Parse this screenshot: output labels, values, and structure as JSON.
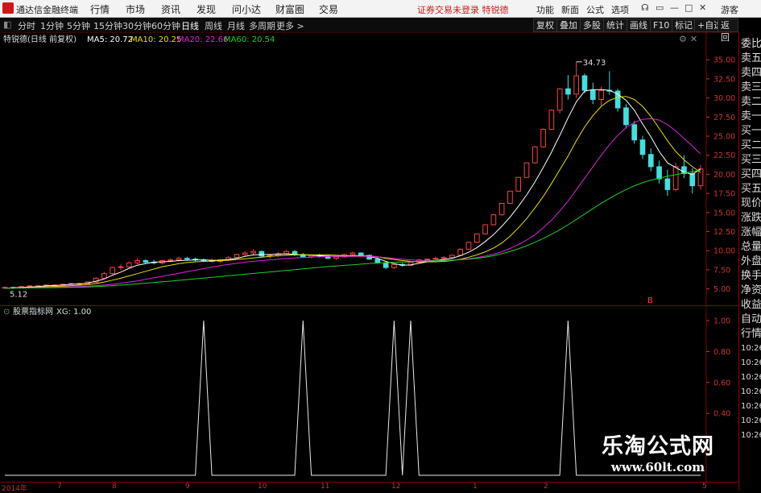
{
  "app": {
    "title": "通达信金融终端"
  },
  "menu": [
    "行情",
    "市场",
    "资讯",
    "发现",
    "问小达",
    "财富圈",
    "交易"
  ],
  "warning": "证券交易未登录 特锐德",
  "toolbar_right": [
    "功能",
    "新面",
    "公式",
    "选项"
  ],
  "user": "游客",
  "periods": [
    "分时",
    "1分钟",
    "5分钟",
    "15分钟",
    "30分钟",
    "60分钟",
    "日线",
    "周线",
    "月线",
    "多周期",
    "更多 >"
  ],
  "active_period": "日线",
  "right_tabs": [
    "复权",
    "叠加",
    "多股",
    "统计",
    "画线",
    "F10",
    "标记",
    "+自选",
    "返回"
  ],
  "info_line": {
    "stock": "特锐德(日线 前复权)",
    "ma5": "MA5: 20.72",
    "ma10": "MA10: 20.25",
    "ma20": "MA20: 22.66",
    "ma60": "MA60: 20.54"
  },
  "indicator_line": {
    "name": "股票指标网",
    "value": "XG: 1.00"
  },
  "right_panel": [
    "委比",
    "卖五",
    "卖四",
    "卖三",
    "卖二",
    "卖一",
    "买一",
    "买二",
    "买三",
    "买四",
    "买五",
    "现价",
    "涨跌",
    "涨幅",
    "总量",
    "外盘",
    "换手",
    "净资",
    "收益",
    "自动",
    "行情",
    "10:26",
    "10:26",
    "10:26",
    "10:26",
    "10:26",
    "10:26",
    "10:26"
  ],
  "high_label": "34.73",
  "low_label": "5.12",
  "marker_b": "B",
  "colors": {
    "ma5": "#ffffff",
    "ma10": "#e8e000",
    "ma20": "#e020e0",
    "ma60": "#20d020",
    "up": "#ff4040",
    "down": "#40e0e0",
    "axis": "#cc2222"
  },
  "chart_data": [
    {
      "type": "candlestick",
      "title": "特锐德(日线 前复权)",
      "ylim": [
        3.8,
        36.5
      ],
      "yticks": [
        "35.00",
        "32.50",
        "30.00",
        "27.50",
        "25.00",
        "22.50",
        "20.00",
        "17.50",
        "15.00",
        "12.50",
        "10.00",
        "7.50",
        "5.00"
      ],
      "yvalues": [
        35,
        32.5,
        30,
        27.5,
        25,
        22.5,
        20,
        17.5,
        15,
        12.5,
        10,
        7.5,
        5
      ],
      "x_labels": [
        "2014年",
        "7",
        "8",
        "9",
        "10",
        "11",
        "12",
        "1",
        "2",
        "5"
      ],
      "ohlc": [
        [
          5.1,
          5.3,
          5.0,
          5.2
        ],
        [
          5.2,
          5.3,
          5.0,
          5.1
        ],
        [
          5.1,
          5.4,
          5.1,
          5.3
        ],
        [
          5.3,
          5.5,
          5.2,
          5.4
        ],
        [
          5.4,
          5.5,
          5.3,
          5.4
        ],
        [
          5.4,
          5.6,
          5.3,
          5.5
        ],
        [
          5.5,
          5.6,
          5.4,
          5.5
        ],
        [
          5.5,
          5.7,
          5.4,
          5.6
        ],
        [
          5.6,
          5.8,
          5.5,
          5.7
        ],
        [
          5.7,
          5.8,
          5.6,
          5.7
        ],
        [
          5.7,
          6.0,
          5.7,
          5.9
        ],
        [
          5.9,
          6.5,
          5.8,
          6.4
        ],
        [
          6.4,
          7.2,
          6.3,
          7.0
        ],
        [
          7.0,
          7.9,
          6.9,
          7.8
        ],
        [
          7.8,
          8.2,
          7.5,
          7.9
        ],
        [
          7.9,
          8.6,
          7.8,
          8.4
        ],
        [
          8.4,
          9.0,
          8.2,
          8.7
        ],
        [
          8.7,
          8.9,
          8.3,
          8.5
        ],
        [
          8.5,
          8.8,
          8.2,
          8.4
        ],
        [
          8.4,
          8.8,
          8.2,
          8.7
        ],
        [
          8.7,
          9.0,
          8.5,
          8.8
        ],
        [
          8.8,
          9.2,
          8.6,
          9.0
        ],
        [
          9.0,
          9.2,
          8.7,
          8.9
        ],
        [
          8.9,
          9.1,
          8.6,
          8.8
        ],
        [
          8.8,
          9.0,
          8.5,
          8.7
        ],
        [
          8.7,
          8.9,
          8.5,
          8.6
        ],
        [
          8.6,
          8.9,
          8.4,
          8.8
        ],
        [
          8.8,
          9.3,
          8.7,
          9.1
        ],
        [
          9.1,
          9.6,
          9.0,
          9.5
        ],
        [
          9.5,
          9.9,
          9.3,
          9.7
        ],
        [
          9.7,
          10.2,
          9.4,
          9.9
        ],
        [
          9.9,
          10.0,
          9.2,
          9.3
        ],
        [
          9.3,
          9.6,
          9.0,
          9.4
        ],
        [
          9.4,
          9.8,
          9.2,
          9.6
        ],
        [
          9.6,
          10.1,
          9.4,
          9.9
        ],
        [
          9.9,
          10.1,
          9.3,
          9.5
        ],
        [
          9.5,
          9.7,
          9.1,
          9.2
        ],
        [
          9.2,
          9.5,
          9.0,
          9.4
        ],
        [
          9.4,
          9.6,
          9.1,
          9.3
        ],
        [
          9.3,
          9.5,
          8.9,
          9.0
        ],
        [
          9.0,
          9.3,
          8.8,
          9.2
        ],
        [
          9.2,
          9.6,
          9.1,
          9.5
        ],
        [
          9.5,
          9.9,
          9.3,
          9.7
        ],
        [
          9.7,
          9.8,
          9.3,
          9.4
        ],
        [
          9.4,
          9.5,
          8.8,
          8.9
        ],
        [
          8.9,
          9.1,
          8.3,
          8.4
        ],
        [
          8.4,
          8.6,
          7.6,
          7.8
        ],
        [
          7.8,
          8.3,
          7.6,
          8.2
        ],
        [
          8.2,
          8.4,
          7.9,
          8.1
        ],
        [
          8.1,
          8.6,
          8.0,
          8.5
        ],
        [
          8.5,
          8.9,
          8.4,
          8.8
        ],
        [
          8.8,
          9.0,
          8.6,
          8.9
        ],
        [
          8.9,
          9.2,
          8.7,
          9.0
        ],
        [
          9.0,
          9.3,
          8.8,
          9.1
        ],
        [
          9.1,
          9.5,
          9.0,
          9.4
        ],
        [
          9.4,
          10.3,
          9.3,
          10.2
        ],
        [
          10.2,
          11.2,
          10.1,
          11.1
        ],
        [
          11.1,
          12.2,
          11.0,
          12.2
        ],
        [
          12.2,
          13.4,
          12.1,
          13.4
        ],
        [
          13.4,
          14.8,
          13.3,
          14.7
        ],
        [
          14.7,
          16.2,
          14.6,
          16.2
        ],
        [
          16.2,
          17.8,
          16.1,
          17.8
        ],
        [
          17.8,
          19.6,
          17.7,
          19.6
        ],
        [
          19.6,
          21.5,
          19.5,
          21.5
        ],
        [
          21.5,
          23.7,
          21.4,
          23.6
        ],
        [
          23.6,
          26.0,
          23.5,
          25.9
        ],
        [
          25.9,
          28.5,
          25.8,
          28.4
        ],
        [
          28.4,
          31.3,
          28.0,
          31.2
        ],
        [
          31.2,
          33.0,
          29.8,
          30.5
        ],
        [
          30.5,
          34.73,
          30.0,
          32.9
        ],
        [
          32.9,
          33.2,
          30.6,
          31.0
        ],
        [
          31.0,
          32.0,
          29.2,
          29.8
        ],
        [
          29.8,
          31.5,
          29.0,
          31.0
        ],
        [
          31.0,
          33.5,
          30.4,
          30.9
        ],
        [
          30.9,
          31.2,
          28.2,
          28.7
        ],
        [
          28.7,
          29.2,
          26.0,
          26.5
        ],
        [
          26.5,
          27.0,
          24.0,
          24.5
        ],
        [
          24.5,
          25.0,
          22.0,
          22.6
        ],
        [
          22.6,
          23.4,
          20.4,
          21.0
        ],
        [
          21.0,
          21.8,
          18.8,
          19.4
        ],
        [
          19.4,
          20.6,
          17.2,
          18.0
        ],
        [
          18.0,
          21.5,
          17.8,
          21.0
        ],
        [
          21.0,
          22.5,
          19.5,
          20.1
        ],
        [
          20.1,
          20.8,
          17.5,
          18.5
        ],
        [
          18.5,
          21.2,
          18.0,
          20.7
        ]
      ],
      "ma_series": [
        {
          "name": "MA5",
          "values": [
            5.1,
            5.15,
            5.2,
            5.25,
            5.3,
            5.4,
            5.45,
            5.5,
            5.6,
            5.65,
            5.75,
            6.0,
            6.3,
            6.8,
            7.2,
            7.7,
            8.1,
            8.3,
            8.5,
            8.55,
            8.6,
            8.7,
            8.75,
            8.8,
            8.8,
            8.75,
            8.75,
            8.85,
            9.0,
            9.25,
            9.45,
            9.5,
            9.5,
            9.55,
            9.6,
            9.5,
            9.45,
            9.4,
            9.35,
            9.3,
            9.25,
            9.3,
            9.35,
            9.35,
            9.25,
            9.0,
            8.6,
            8.3,
            8.1,
            8.15,
            8.35,
            8.55,
            8.7,
            8.85,
            9.0,
            9.35,
            9.8,
            10.4,
            11.2,
            12.1,
            13.2,
            14.4,
            15.8,
            17.3,
            19.0,
            20.9,
            22.9,
            25.1,
            27.4,
            29.5,
            30.9,
            31.1,
            31.1,
            31.0,
            30.5,
            29.7,
            28.4,
            26.6,
            24.9,
            23.0,
            21.5,
            20.9,
            20.3,
            20.0,
            20.7
          ]
        },
        {
          "name": "MA10",
          "values": [
            5.1,
            5.12,
            5.15,
            5.18,
            5.22,
            5.28,
            5.32,
            5.36,
            5.42,
            5.48,
            5.55,
            5.7,
            5.9,
            6.15,
            6.4,
            6.7,
            7.0,
            7.3,
            7.6,
            7.9,
            8.1,
            8.3,
            8.45,
            8.55,
            8.6,
            8.65,
            8.7,
            8.75,
            8.85,
            8.95,
            9.05,
            9.15,
            9.25,
            9.35,
            9.4,
            9.45,
            9.45,
            9.45,
            9.45,
            9.45,
            9.4,
            9.35,
            9.35,
            9.35,
            9.3,
            9.2,
            9.0,
            8.85,
            8.7,
            8.6,
            8.55,
            8.55,
            8.55,
            8.6,
            8.7,
            8.9,
            9.15,
            9.45,
            9.85,
            10.35,
            11.0,
            11.9,
            13.0,
            14.2,
            15.6,
            17.1,
            18.8,
            20.6,
            22.4,
            24.4,
            26.2,
            27.7,
            28.9,
            29.7,
            30.1,
            30.2,
            29.8,
            28.9,
            27.6,
            26.0,
            24.4,
            23.0,
            21.9,
            21.0,
            20.25
          ]
        },
        {
          "name": "MA20",
          "values": [
            5.1,
            5.11,
            5.12,
            5.14,
            5.16,
            5.19,
            5.22,
            5.25,
            5.28,
            5.31,
            5.35,
            5.42,
            5.5,
            5.6,
            5.75,
            5.9,
            6.05,
            6.25,
            6.45,
            6.65,
            6.85,
            7.05,
            7.25,
            7.45,
            7.65,
            7.85,
            8.05,
            8.2,
            8.35,
            8.5,
            8.6,
            8.7,
            8.8,
            8.9,
            9.0,
            9.05,
            9.1,
            9.15,
            9.2,
            9.25,
            9.25,
            9.25,
            9.25,
            9.25,
            9.25,
            9.2,
            9.1,
            9.0,
            8.9,
            8.8,
            8.75,
            8.7,
            8.7,
            8.7,
            8.75,
            8.85,
            8.95,
            9.1,
            9.3,
            9.55,
            9.85,
            10.3,
            10.8,
            11.4,
            12.1,
            13.0,
            14.0,
            15.2,
            16.5,
            18.0,
            19.5,
            21.0,
            22.5,
            23.9,
            25.1,
            26.1,
            26.8,
            27.2,
            27.3,
            27.1,
            26.5,
            25.7,
            24.7,
            23.7,
            22.66
          ]
        },
        {
          "name": "MA60",
          "values": [
            5.1,
            5.1,
            5.11,
            5.12,
            5.13,
            5.14,
            5.16,
            5.18,
            5.2,
            5.22,
            5.25,
            5.3,
            5.35,
            5.42,
            5.5,
            5.58,
            5.66,
            5.75,
            5.84,
            5.93,
            6.02,
            6.12,
            6.22,
            6.32,
            6.42,
            6.52,
            6.62,
            6.72,
            6.82,
            6.92,
            7.02,
            7.12,
            7.22,
            7.32,
            7.42,
            7.52,
            7.62,
            7.72,
            7.82,
            7.92,
            8.0,
            8.08,
            8.16,
            8.24,
            8.32,
            8.38,
            8.44,
            8.48,
            8.52,
            8.56,
            8.6,
            8.64,
            8.68,
            8.72,
            8.76,
            8.82,
            8.9,
            9.0,
            9.15,
            9.35,
            9.6,
            9.9,
            10.25,
            10.65,
            11.1,
            11.6,
            12.15,
            12.75,
            13.4,
            14.1,
            14.8,
            15.5,
            16.2,
            16.85,
            17.45,
            18.0,
            18.5,
            18.9,
            19.25,
            19.5,
            19.75,
            19.95,
            20.15,
            20.35,
            20.54
          ]
        }
      ]
    },
    {
      "type": "line",
      "title": "股票指标网",
      "ylim": [
        0,
        1
      ],
      "yticks": [
        "1.00",
        "0.80",
        "0.60",
        "0.40"
      ],
      "yvalues": [
        1.0,
        0.8,
        0.6,
        0.4
      ],
      "series": [
        {
          "name": "XG",
          "signal_days": [
            24,
            36,
            47,
            49,
            68
          ]
        }
      ]
    }
  ]
}
